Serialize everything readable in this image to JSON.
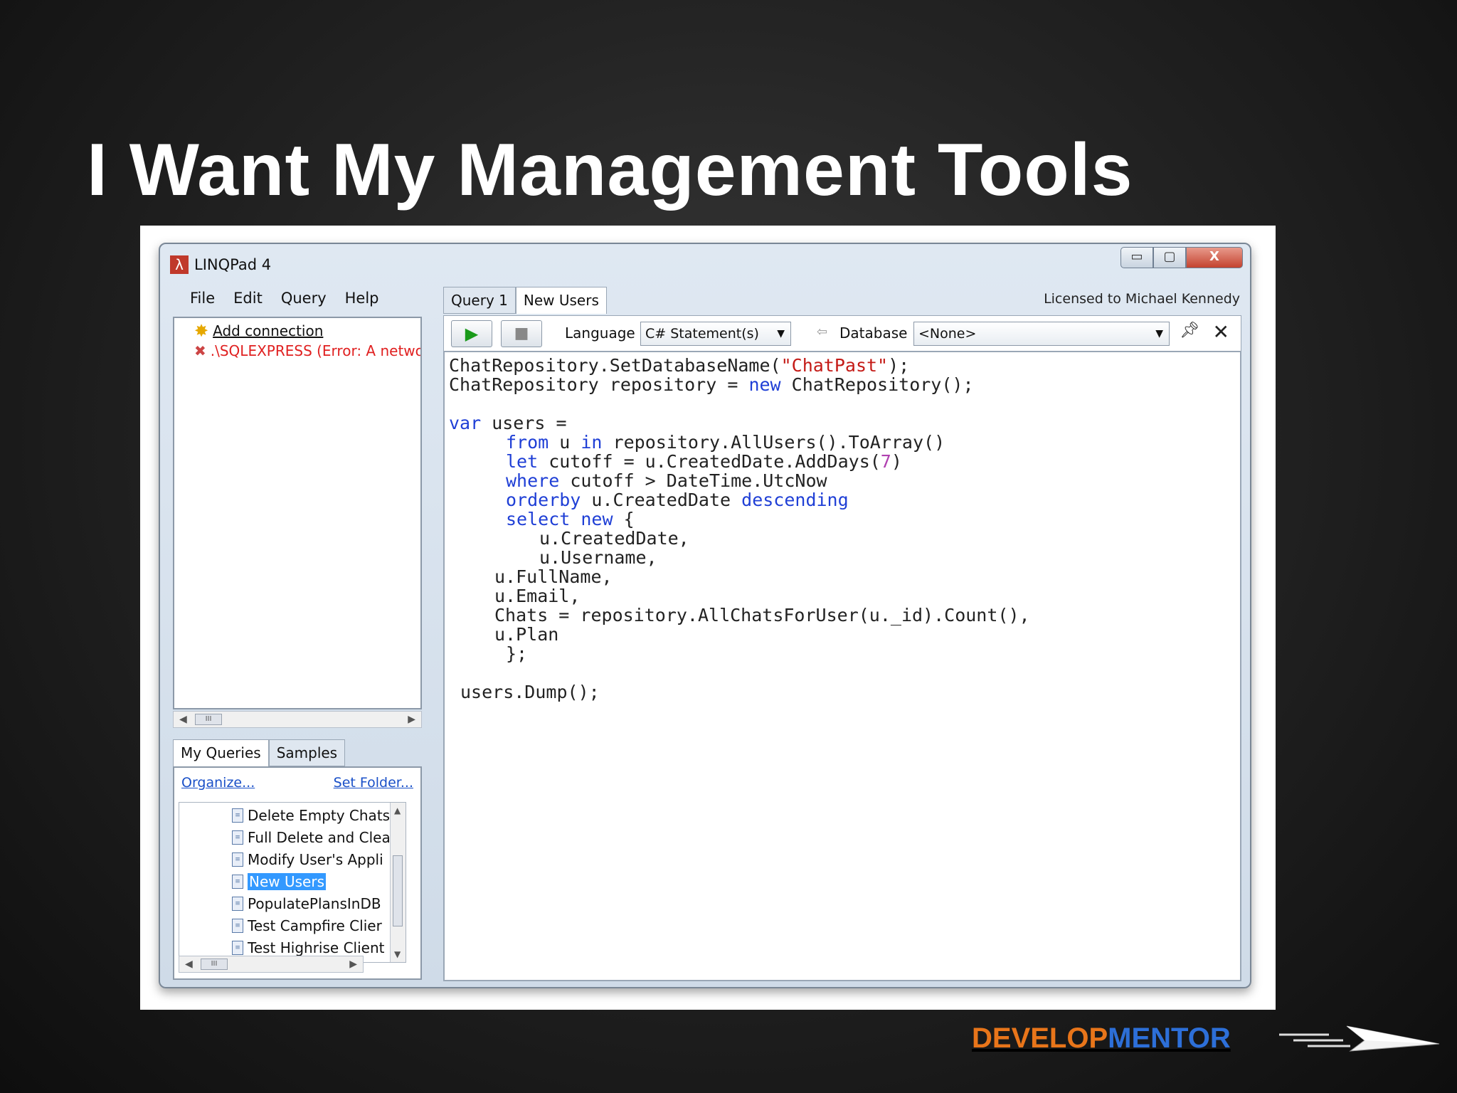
{
  "slide": {
    "title": "I Want My Management Tools",
    "brand_develop": "DEVELOP",
    "brand_mentor": "MENTOR"
  },
  "window": {
    "title": "LINQPad 4",
    "buttons": {
      "minimize": "▭",
      "maximize": "▢",
      "close": "X"
    }
  },
  "menu": [
    "File",
    "Edit",
    "Query",
    "Help"
  ],
  "connections": {
    "add_label": "Add connection",
    "server_error": ".\\SQLEXPRESS (Error: A netwo"
  },
  "queries_panel": {
    "tabs": [
      "My Queries",
      "Samples"
    ],
    "organize_link": "Organize...",
    "set_folder_link": "Set Folder...",
    "items": [
      "Delete Empty Chats",
      "Full Delete and Clea",
      "Modify User's Appli",
      "New Users",
      "PopulatePlansInDB",
      "Test Campfire Clier",
      "Test Highrise Client"
    ],
    "selected": "New Users"
  },
  "editor": {
    "tabs": [
      "Query 1",
      "New Users"
    ],
    "active_tab": "New Users",
    "license": "Licensed to Michael Kennedy",
    "language_label": "Language",
    "language_value": "C# Statement(s)",
    "database_label": "Database",
    "database_value": "<None>",
    "code": {
      "l1a": "ChatRepository.SetDatabaseName(",
      "l1s": "\"ChatPast\"",
      "l1b": ");",
      "l2a": "ChatRepository repository = ",
      "l2k": "new",
      "l2b": " ChatRepository();",
      "l3k": "var",
      "l3b": " users =",
      "l4k1": "from",
      "l4a": " u ",
      "l4k2": "in",
      "l4b": " repository.AllUsers().ToArray()",
      "l5k": "let",
      "l5a": " cutoff = u.CreatedDate.AddDays(",
      "l5n": "7",
      "l5b": ")",
      "l6k": "where",
      "l6a": " cutoff > DateTime.UtcNow",
      "l7k": "orderby",
      "l7a": " u.CreatedDate ",
      "l7k2": "descending",
      "l8k1": "select",
      "l8k2": " new",
      "l8a": " {",
      "l9": "u.CreatedDate,",
      "l10": "u.Username,",
      "l11": "u.FullName,",
      "l12": "u.Email,",
      "l13": "Chats = repository.AllChatsForUser(u._id).Count(),",
      "l14": "u.Plan",
      "l15": "};",
      "l16": "users.Dump();"
    }
  },
  "colors": {
    "keyword": "#1f3fd6",
    "string": "#c41a16",
    "number": "#b040b0",
    "brand_orange": "#e8751a",
    "brand_blue": "#2d6fd8"
  }
}
